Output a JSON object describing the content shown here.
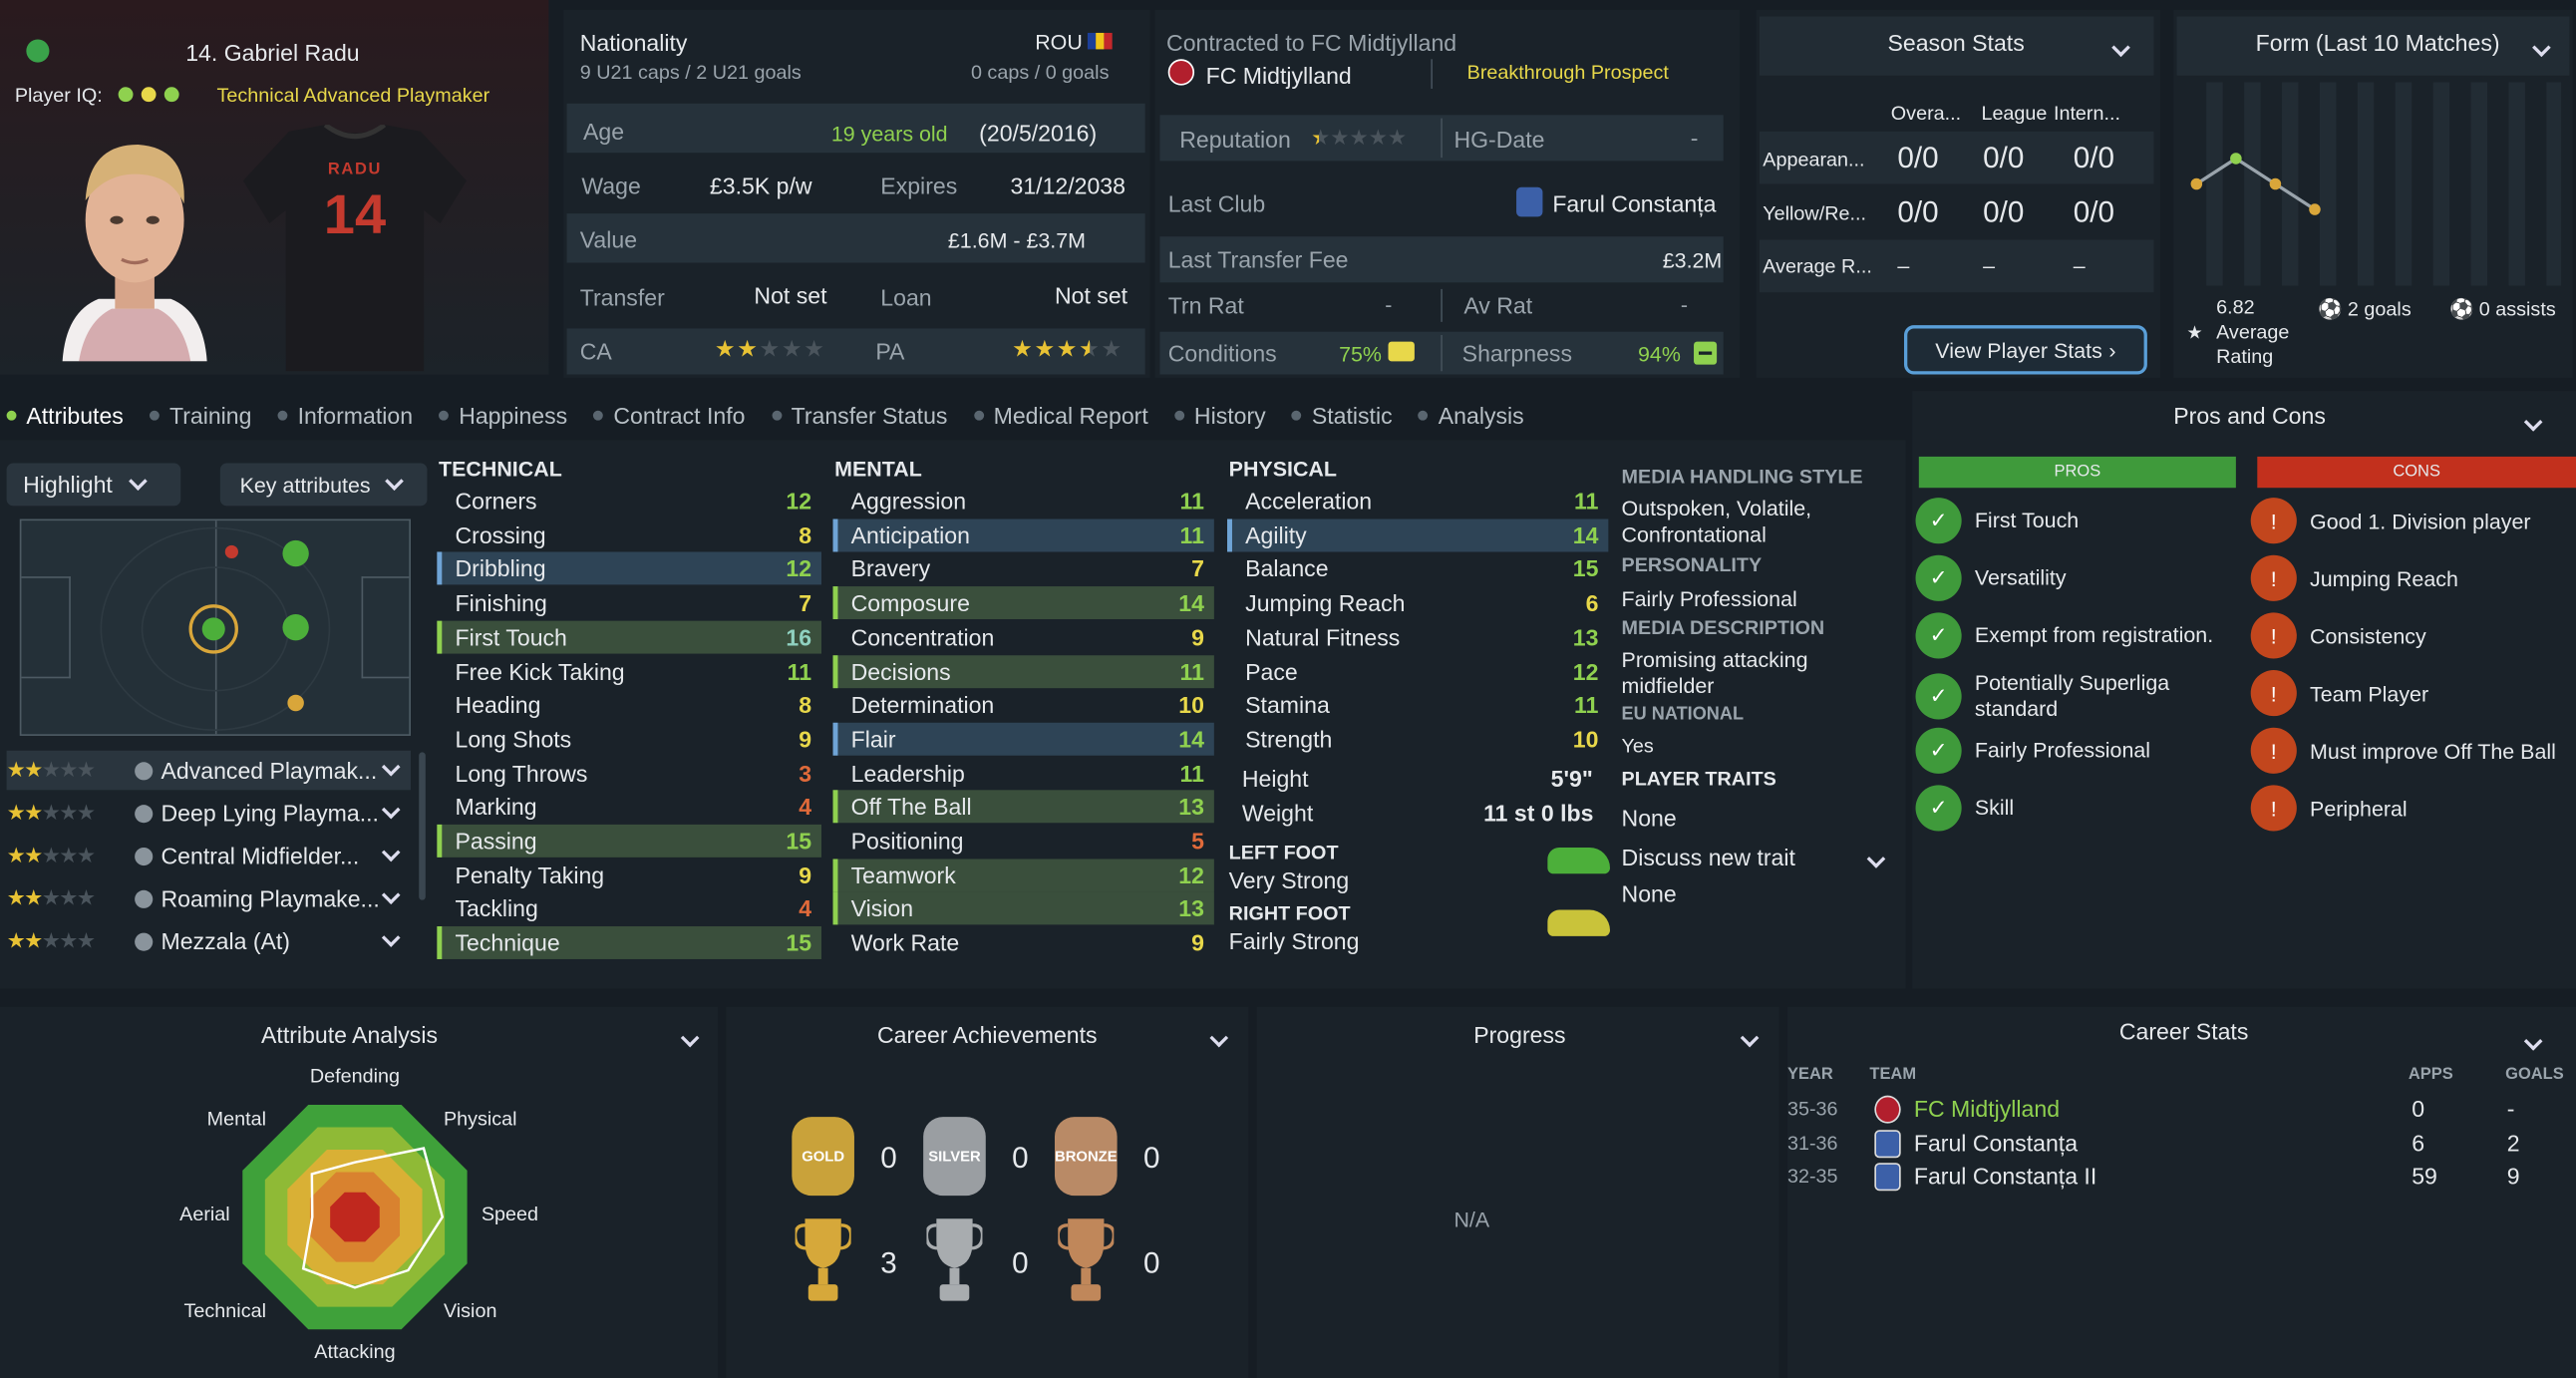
{
  "player": {
    "name": "14. Gabriel Radu",
    "iq_label": "Player IQ:",
    "role": "Technical Advanced Playmaker",
    "shirt_name": "RADU",
    "shirt_number": "14"
  },
  "nationality": {
    "label": "Nationality",
    "country": "ROU",
    "caps_u21": "9 U21 caps / 2 U21 goals",
    "caps": "0 caps / 0 goals"
  },
  "info": {
    "age_label": "Age",
    "age": "19 years old",
    "dob": "(20/5/2016)",
    "wage_label": "Wage",
    "wage": "£3.5K p/w",
    "expires_label": "Expires",
    "expires": "31/12/2038",
    "value_label": "Value",
    "value": "£1.6M - £3.7M",
    "transfer_label": "Transfer",
    "transfer": "Not set",
    "loan_label": "Loan",
    "loan": "Not set",
    "ca_label": "CA",
    "pa_label": "PA",
    "ca_stars": 2,
    "pa_stars": 3.5
  },
  "contract": {
    "contracted": "Contracted to FC Midtjylland",
    "club": "FC Midtjylland",
    "tag": "Breakthrough Prospect",
    "reputation_label": "Reputation",
    "hg_label": "HG-Date",
    "hg_value": "-",
    "last_club_label": "Last Club",
    "last_club": "Farul Constanța",
    "last_fee_label": "Last Transfer Fee",
    "last_fee": "£3.2M",
    "trn_label": "Trn Rat",
    "trn_value": "-",
    "av_label": "Av Rat",
    "av_value": "-",
    "conditions_label": "Conditions",
    "conditions": "75%",
    "sharpness_label": "Sharpness",
    "sharpness": "94%"
  },
  "season": {
    "title": "Season Stats",
    "cols": [
      "Overa...",
      "League",
      "Intern..."
    ],
    "rows": [
      {
        "label": "Appearan...",
        "vals": [
          "0/0",
          "0/0",
          "0/0"
        ]
      },
      {
        "label": "Yellow/Re...",
        "vals": [
          "0/0",
          "0/0",
          "0/0"
        ]
      },
      {
        "label": "Average R...",
        "vals": [
          "–",
          "–",
          "–"
        ]
      }
    ],
    "button": "View Player Stats"
  },
  "form": {
    "title": "Form (Last 10 Matches)",
    "rating": "6.82",
    "rating_label": "Average Rating",
    "goals": "2 goals",
    "assists": "0 assists",
    "points": [
      6.8,
      7.0,
      6.8,
      6.6
    ]
  },
  "tabs": [
    "Attributes",
    "Training",
    "Information",
    "Happiness",
    "Contract Info",
    "Transfer Status",
    "Medical Report",
    "History",
    "Statistic",
    "Analysis"
  ],
  "controls": {
    "highlight": "Highlight",
    "key": "Key attributes"
  },
  "roles": [
    {
      "name": "Advanced Playmak...",
      "stars": 2
    },
    {
      "name": "Deep Lying Playma...",
      "stars": 2
    },
    {
      "name": "Central Midfielder...",
      "stars": 2
    },
    {
      "name": "Roaming Playmake...",
      "stars": 2
    },
    {
      "name": "Mezzala (At)",
      "stars": 2
    }
  ],
  "technical": {
    "title": "TECHNICAL",
    "items": [
      {
        "n": "Corners",
        "v": "12"
      },
      {
        "n": "Crossing",
        "v": "8"
      },
      {
        "n": "Dribbling",
        "v": "12"
      },
      {
        "n": "Finishing",
        "v": "7"
      },
      {
        "n": "First Touch",
        "v": "16"
      },
      {
        "n": "Free Kick Taking",
        "v": "11"
      },
      {
        "n": "Heading",
        "v": "8"
      },
      {
        "n": "Long Shots",
        "v": "9"
      },
      {
        "n": "Long Throws",
        "v": "3"
      },
      {
        "n": "Marking",
        "v": "4"
      },
      {
        "n": "Passing",
        "v": "15"
      },
      {
        "n": "Penalty Taking",
        "v": "9"
      },
      {
        "n": "Tackling",
        "v": "4"
      },
      {
        "n": "Technique",
        "v": "15"
      }
    ]
  },
  "mental": {
    "title": "MENTAL",
    "items": [
      {
        "n": "Aggression",
        "v": "11"
      },
      {
        "n": "Anticipation",
        "v": "11"
      },
      {
        "n": "Bravery",
        "v": "7"
      },
      {
        "n": "Composure",
        "v": "14"
      },
      {
        "n": "Concentration",
        "v": "9"
      },
      {
        "n": "Decisions",
        "v": "11"
      },
      {
        "n": "Determination",
        "v": "10"
      },
      {
        "n": "Flair",
        "v": "14"
      },
      {
        "n": "Leadership",
        "v": "11"
      },
      {
        "n": "Off The Ball",
        "v": "13"
      },
      {
        "n": "Positioning",
        "v": "5"
      },
      {
        "n": "Teamwork",
        "v": "12"
      },
      {
        "n": "Vision",
        "v": "13"
      },
      {
        "n": "Work Rate",
        "v": "9"
      }
    ]
  },
  "physical": {
    "title": "PHYSICAL",
    "items": [
      {
        "n": "Acceleration",
        "v": "11"
      },
      {
        "n": "Agility",
        "v": "14"
      },
      {
        "n": "Balance",
        "v": "15"
      },
      {
        "n": "Jumping Reach",
        "v": "6"
      },
      {
        "n": "Natural Fitness",
        "v": "13"
      },
      {
        "n": "Pace",
        "v": "12"
      },
      {
        "n": "Stamina",
        "v": "11"
      },
      {
        "n": "Strength",
        "v": "10"
      }
    ],
    "height_label": "Height",
    "height": "5'9\"",
    "weight_label": "Weight",
    "weight": "11 st 0 lbs",
    "left_label": "LEFT FOOT",
    "left": "Very Strong",
    "right_label": "RIGHT FOOT",
    "right": "Fairly Strong"
  },
  "media": {
    "style_label": "MEDIA HANDLING STYLE",
    "style": "Outspoken, Volatile, Confrontational",
    "personality_label": "PERSONALITY",
    "personality": "Fairly Professional",
    "desc_label": "MEDIA DESCRIPTION",
    "desc": "Promising attacking midfielder",
    "eu_label": "EU NATIONAL",
    "eu": "Yes",
    "traits_label": "PLAYER TRAITS",
    "traits": "None",
    "discuss": "Discuss new trait",
    "discuss_value": "None"
  },
  "pros_cons": {
    "title": "Pros and Cons",
    "pros_label": "PROS",
    "cons_label": "CONS",
    "pros": [
      "First Touch",
      "Versatility",
      "Exempt from registration.",
      "Potentially Superliga standard",
      "Fairly Professional",
      "Skill"
    ],
    "cons": [
      "Good 1. Division player",
      "Jumping Reach",
      "Consistency",
      "Team Player",
      "Must improve Off The Ball",
      "Peripheral"
    ]
  },
  "analysis": {
    "title": "Attribute Analysis",
    "axes": [
      "Defending",
      "Physical",
      "Speed",
      "Vision",
      "Attacking",
      "Technical",
      "Aerial",
      "Mental"
    ],
    "values": [
      0.45,
      0.8,
      0.72,
      0.62,
      0.58,
      0.6,
      0.35,
      0.5
    ]
  },
  "achievements": {
    "title": "Career Achievements",
    "medals": [
      {
        "label": "GOLD",
        "count": "0"
      },
      {
        "label": "SILVER",
        "count": "0"
      },
      {
        "label": "BRONZE",
        "count": "0"
      }
    ],
    "trophies": [
      "3",
      "0",
      "0"
    ]
  },
  "progress": {
    "title": "Progress",
    "value": "N/A"
  },
  "career": {
    "title": "Career Stats",
    "cols": [
      "YEAR",
      "TEAM",
      "APPS",
      "GOALS"
    ],
    "rows": [
      {
        "year": "35-36",
        "team": "FC Midtjylland",
        "apps": "0",
        "goals": "-"
      },
      {
        "year": "31-36",
        "team": "Farul Constanța",
        "apps": "6",
        "goals": "2"
      },
      {
        "year": "32-35",
        "team": "Farul Constanța II",
        "apps": "59",
        "goals": "9"
      }
    ]
  },
  "colors": {
    "accent": "#8fd14f",
    "yellow": "#e8d84a",
    "pro": "#3f9a3b",
    "con": "#c2461d"
  }
}
